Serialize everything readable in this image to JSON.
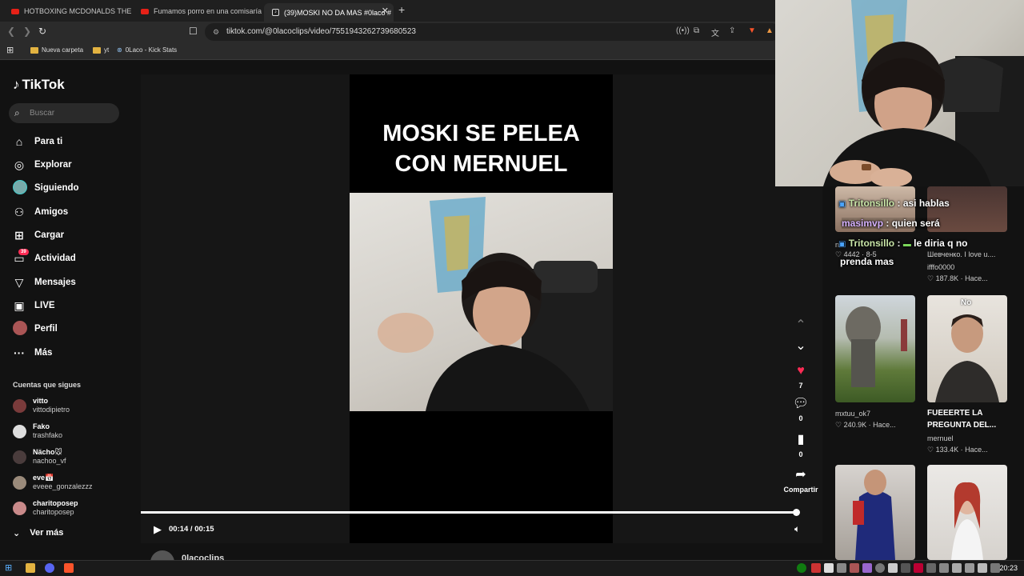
{
  "browser": {
    "tabs": [
      {
        "label": "HOTBOXING MCDONALDS THEN OR",
        "icon": "youtube-icon"
      },
      {
        "label": "Fumamos porro en una comisaría de",
        "icon": "youtube-icon"
      },
      {
        "label": "(39)MOSKI NO DA MAS #0laco #",
        "icon": "tiktok-icon"
      }
    ],
    "url": "tiktok.com/@0lacoclips/video/7551943262739680523",
    "bookmarks": [
      "Nueva carpeta",
      "yt",
      "0Laco - Kick Stats"
    ]
  },
  "tiktok": {
    "logo": "TikTok",
    "search_placeholder": "Buscar",
    "nav": [
      {
        "label": "Para ti",
        "icon": "home-icon"
      },
      {
        "label": "Explorar",
        "icon": "compass-icon"
      },
      {
        "label": "Siguiendo",
        "icon": "avatar"
      },
      {
        "label": "Amigos",
        "icon": "friends-icon"
      },
      {
        "label": "Cargar",
        "icon": "upload-icon"
      },
      {
        "label": "Actividad",
        "icon": "inbox-icon",
        "badge": "39"
      },
      {
        "label": "Mensajes",
        "icon": "send-icon"
      },
      {
        "label": "LIVE",
        "icon": "live-icon"
      },
      {
        "label": "Perfil",
        "icon": "avatar"
      },
      {
        "label": "Más",
        "icon": "more-icon"
      }
    ],
    "following_title": "Cuentas que sigues",
    "following": [
      {
        "name": "vitto",
        "handle": "vittodipietro"
      },
      {
        "name": "Fako",
        "handle": "trashfako"
      },
      {
        "name": "Nächo🐭",
        "handle": "nachoo_vf"
      },
      {
        "name": "eve📅",
        "handle": "eveee_gonzalezzz"
      },
      {
        "name": "charitoposep",
        "handle": "charitoposep"
      }
    ],
    "see_more": "Ver más"
  },
  "video": {
    "caption_line1": "MOSKI SE PELEA",
    "caption_line2": "CON MERNUEL",
    "time": "00:14 / 00:15",
    "progress": 0.98,
    "author": "0lacoclips",
    "likes": "7",
    "comments": "0",
    "saves": "0",
    "share_label": "Compartir"
  },
  "related": [
    {
      "meta_left": "4442 · 8-5",
      "user": "n",
      "meta2": ""
    },
    {
      "title": "Шевченко. I love u....",
      "user": "ifffo0000",
      "likes": "187.8K · Hace..."
    },
    {
      "title": "",
      "user": "mxtuu_ok7",
      "likes": "240.9K · Hace..."
    },
    {
      "title": "FUEEERTE LA PREGUNTA DEL...",
      "user": "mernuel",
      "likes": "133.4K · Hace..."
    }
  ],
  "chat": [
    {
      "user": "Tritonsillo",
      "text": "asi hablas"
    },
    {
      "user": "masimvp",
      "text": "quien será"
    },
    {
      "user": "Tritonsillo",
      "text": "le diria q no"
    },
    {
      "user": "",
      "text": "prenda mas"
    }
  ],
  "thumb_overlay": "No",
  "clock": "20:23"
}
